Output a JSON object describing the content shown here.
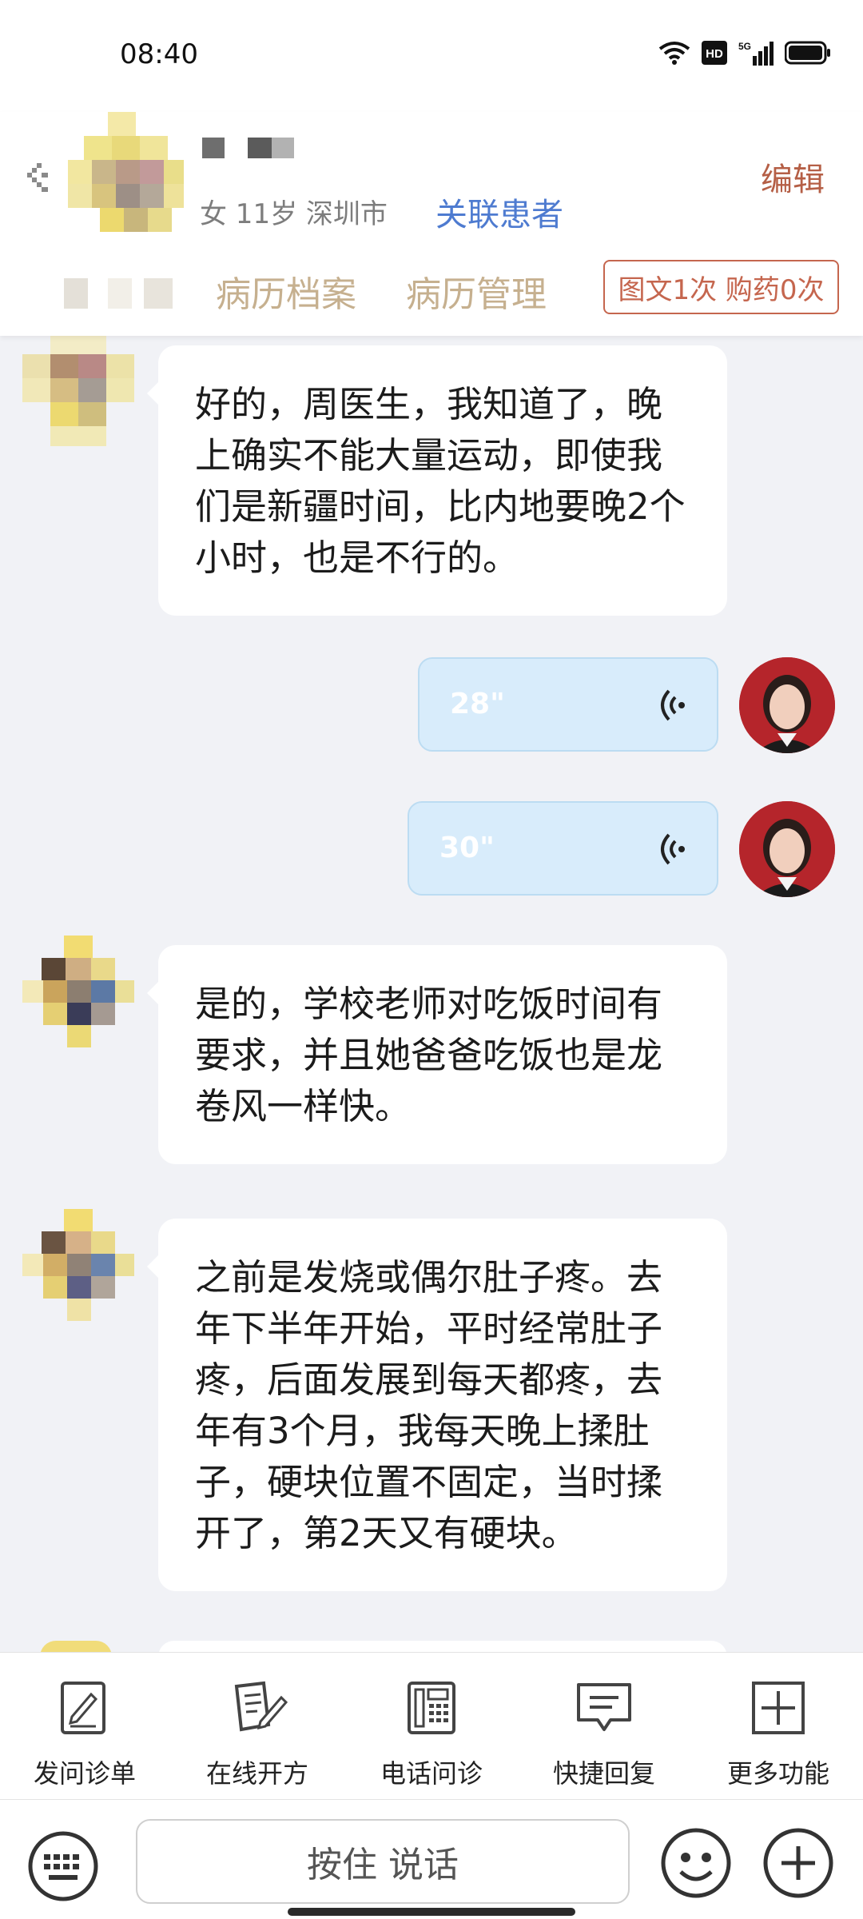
{
  "status_bar": {
    "time": "08:40",
    "icons": [
      "wifi-icon",
      "hd-icon",
      "5g-signal-icon",
      "battery-icon"
    ],
    "hd_label": "HD",
    "net_label": "5G"
  },
  "header": {
    "back_icon": "back-arrow-icon",
    "patient_info": "女 11岁  深圳市",
    "link_patient": "关联患者",
    "edit_label": "编辑",
    "tabs": [
      "病历档案",
      "病历管理"
    ],
    "badge": "图文1次 购药0次"
  },
  "messages": [
    {
      "type": "text",
      "side": "left",
      "text": "好的，周医生，我知道了，晚上确实不能大量运动，即使我们是新疆时间，比内地要晚2个小时，也是不行的。"
    },
    {
      "type": "voice",
      "side": "right",
      "duration": "28\""
    },
    {
      "type": "voice",
      "side": "right",
      "duration": "30\""
    },
    {
      "type": "text",
      "side": "left",
      "text": "是的，学校老师对吃饭时间有要求，并且她爸爸吃饭也是龙卷风一样快。"
    },
    {
      "type": "text",
      "side": "left",
      "text": "之前是发烧或偶尔肚子疼。去年下半年开始，平时经常肚子疼，后面发展到每天都疼，去年有3个月，我每天晚上揉肚子，硬块位置不固定，当时揉开了，第2天又有硬块。"
    }
  ],
  "toolbar": {
    "items": [
      {
        "label": "发问诊单",
        "icon": "questionnaire-icon"
      },
      {
        "label": "在线开方",
        "icon": "prescription-icon"
      },
      {
        "label": "电话问诊",
        "icon": "phone-consult-icon"
      },
      {
        "label": "快捷回复",
        "icon": "quick-reply-icon"
      },
      {
        "label": "更多功能",
        "icon": "more-functions-icon"
      }
    ]
  },
  "input": {
    "talk_label": "按住 说话",
    "left_icon": "keyboard-icon",
    "right_icons": [
      "emoji-icon",
      "plus-icon"
    ]
  },
  "colors": {
    "accent_brown": "#c5664e",
    "link_blue": "#4e7bd0",
    "voice_bg": "#d8ecfb",
    "chat_bg": "#f1f2f6"
  }
}
